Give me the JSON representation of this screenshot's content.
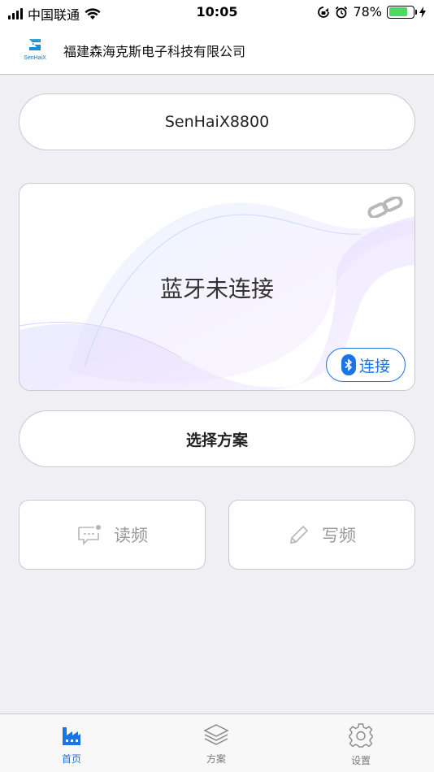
{
  "status_bar": {
    "carrier": "中国联通",
    "time": "10:05",
    "battery": "78%",
    "battery_level": 0.78
  },
  "header": {
    "company_name": "福建森海克斯电子科技有限公司",
    "logo_text": "SenHaiX"
  },
  "device": {
    "name": "SenHaiX8800"
  },
  "bluetooth_card": {
    "status": "蓝牙未连接",
    "connect_label": "连接",
    "icons": [
      "link-icon",
      "bluetooth-icon"
    ]
  },
  "plan": {
    "select_label": "选择方案"
  },
  "actions": {
    "read_label": "读频",
    "write_label": "写频"
  },
  "tabs": [
    {
      "label": "首页",
      "icon": "factory-icon",
      "active": true
    },
    {
      "label": "方案",
      "icon": "layers-icon",
      "active": false
    },
    {
      "label": "设置",
      "icon": "gear-icon",
      "active": false
    }
  ],
  "colors": {
    "accent": "#1a73e8",
    "background": "#efeff4",
    "battery": "#4cd964"
  }
}
